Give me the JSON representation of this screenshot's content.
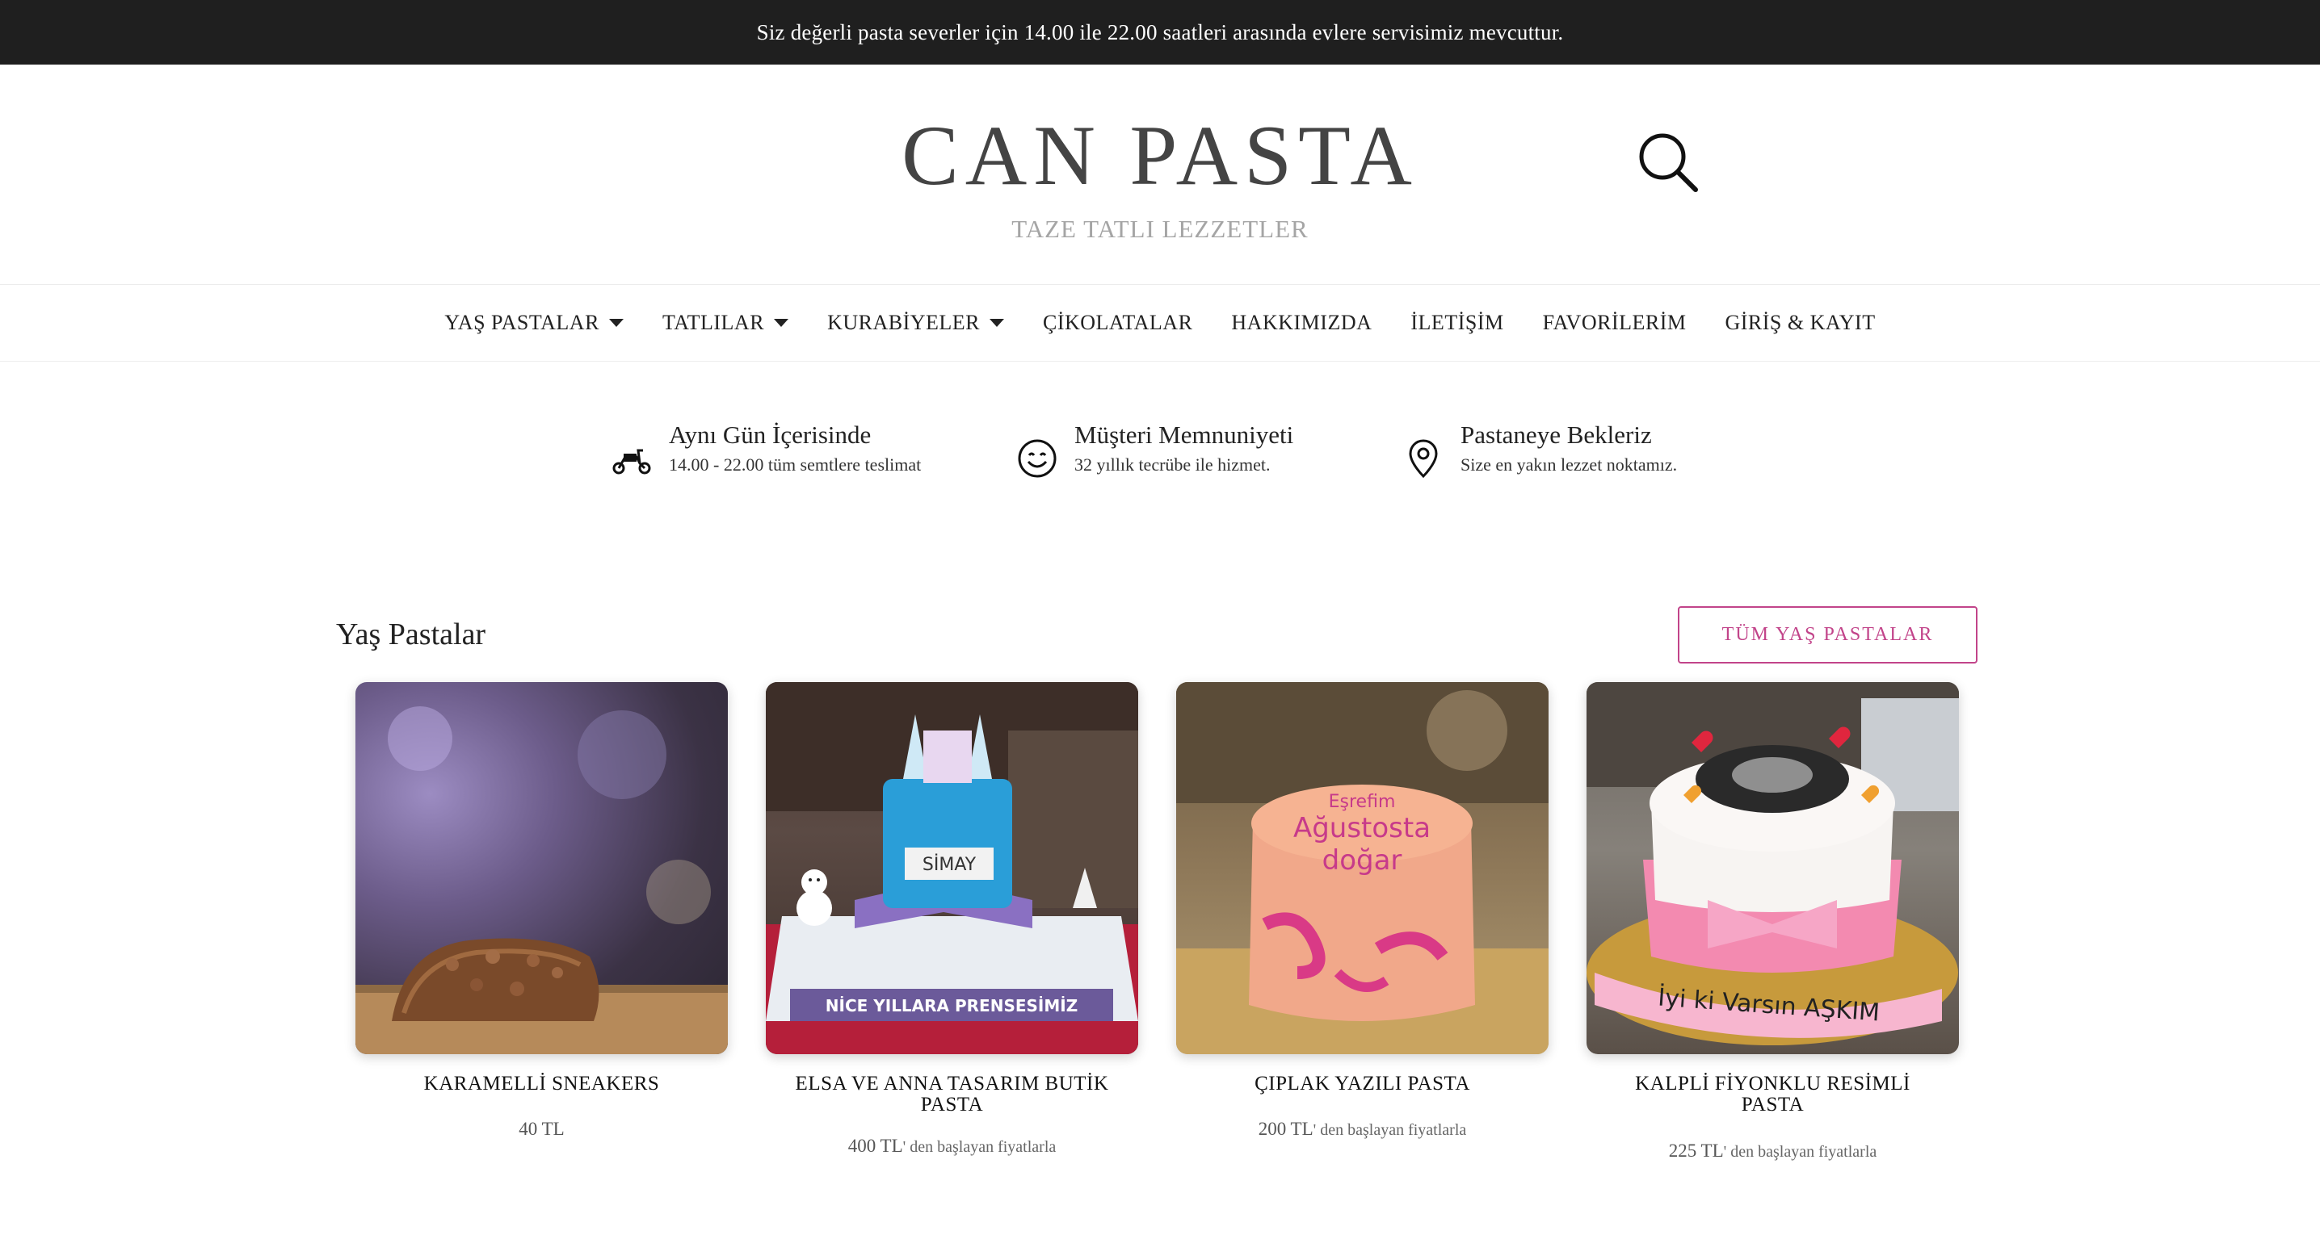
{
  "announcement": "Siz değerli pasta severler için 14.00 ile 22.00 saatleri arasında evlere servisimiz mevcuttur.",
  "brand": {
    "name": "CAN PASTA",
    "tagline": "TAZE TATLI LEZZETLER"
  },
  "nav": {
    "items": [
      {
        "label": "YAŞ PASTALAR",
        "dropdown": true
      },
      {
        "label": "TATLILAR",
        "dropdown": true
      },
      {
        "label": "KURABİYELER",
        "dropdown": true
      },
      {
        "label": "ÇİKOLATALAR",
        "dropdown": false
      },
      {
        "label": "HAKKIMIZDA",
        "dropdown": false
      },
      {
        "label": "İLETİŞİM",
        "dropdown": false
      },
      {
        "label": "FAVORİLERİM",
        "dropdown": false
      },
      {
        "label": "GİRİŞ & KAYIT",
        "dropdown": false
      }
    ]
  },
  "features": [
    {
      "icon": "scooter-icon",
      "title": "Aynı Gün İçerisinde",
      "subtitle": "14.00 - 22.00 tüm semtlere teslimat"
    },
    {
      "icon": "smile-icon",
      "title": "Müşteri Memnuniyeti",
      "subtitle": "32 yıllık tecrübe ile hizmet."
    },
    {
      "icon": "location-pin-icon",
      "title": "Pastaneye Bekleriz",
      "subtitle": "Size en yakın lezzet noktamız."
    }
  ],
  "section": {
    "title": "Yaş Pastalar",
    "all_button": "TÜM YAŞ PASTALAR"
  },
  "products": [
    {
      "name": "KARAMELLİ SNEAKERS",
      "price": "40 TL",
      "price_suffix": ""
    },
    {
      "name": "ELSA VE ANNA TASARIM BUTİK PASTA",
      "price": "400 TL",
      "price_suffix": "' den başlayan fiyatlarla"
    },
    {
      "name": "ÇIPLAK YAZILI PASTA",
      "price": "200 TL",
      "price_suffix": "' den başlayan fiyatlarla"
    },
    {
      "name": "KALPLİ FİYONKLU RESİMLİ PASTA",
      "price": "225 TL",
      "price_suffix": "' den başlayan fiyatlarla"
    }
  ],
  "cake_texts": {
    "elsa_name": "SİMAY",
    "elsa_banner": "NİCE YILLARA PRENSESİMİZ",
    "ciplak_line1": "Eşrefim",
    "ciplak_line2": "Ağustosta",
    "ciplak_line3": "doğar",
    "kalpli_banner": "İyi ki Varsın AŞKIM"
  },
  "colors": {
    "topbar": "#1f1f1f",
    "accent": "#c2448a",
    "text": "#222222",
    "tagline": "#a5a5a5"
  }
}
